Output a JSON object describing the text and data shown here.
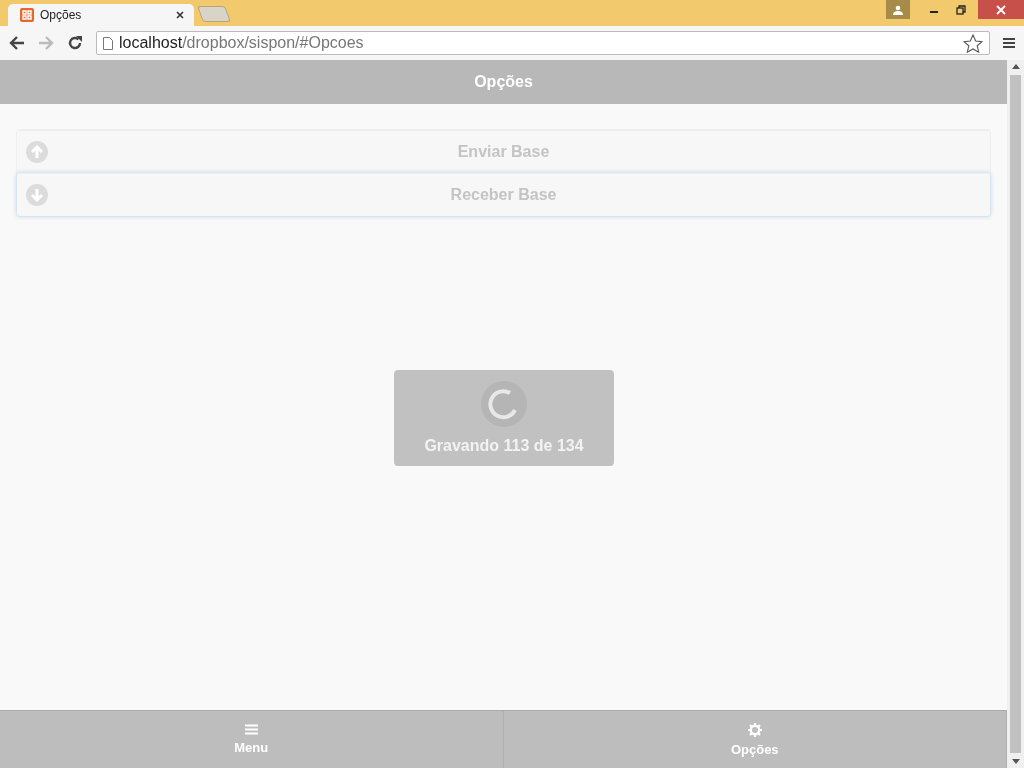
{
  "browser": {
    "tabs": [
      {
        "title": "Opções",
        "selected": true
      }
    ],
    "address": {
      "host": "localhost",
      "path": "/dropbox/sispon/#Opcoes"
    }
  },
  "header": {
    "title": "Opções"
  },
  "options": [
    {
      "label": "Enviar Base",
      "kind": "upload",
      "focused": false
    },
    {
      "label": "Receber Base",
      "kind": "download",
      "focused": true
    }
  ],
  "loader": {
    "message": "Gravando 113 de 134"
  },
  "footer": {
    "items": [
      {
        "label": "Menu",
        "kind": "menu"
      },
      {
        "label": "Opções",
        "kind": "settings"
      }
    ]
  }
}
